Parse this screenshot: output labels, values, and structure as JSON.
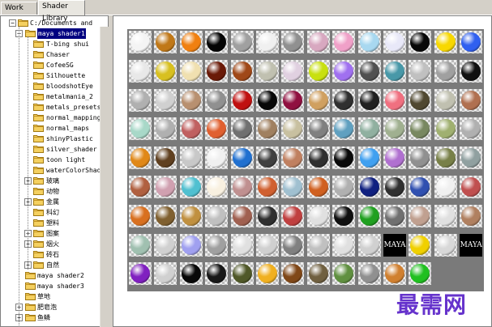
{
  "tabs": [
    {
      "label": "Work Area",
      "active": false
    },
    {
      "label": "Shader Library",
      "active": true
    }
  ],
  "tree": {
    "root": "C:/Documents and",
    "selected": "maya shader1",
    "children_of_selected": [
      "T-bing shui",
      "Chaser",
      "CofeeSG",
      "Silhouette",
      "bloodshotEye",
      "metalmania_2",
      "metals_presets",
      "normal_mapping",
      "normal_maps",
      "shinyPlastic",
      "silver_shader",
      "toon light",
      "waterColorShader"
    ],
    "collapsed_groups": [
      {
        "label": "玻璃",
        "expandable": true
      },
      {
        "label": "动物",
        "expandable": false
      },
      {
        "label": "金属",
        "expandable": true
      },
      {
        "label": "科幻",
        "expandable": false
      },
      {
        "label": "塑料",
        "expandable": false
      },
      {
        "label": "图案",
        "expandable": true
      },
      {
        "label": "烟火",
        "expandable": true
      },
      {
        "label": "砖石",
        "expandable": false
      },
      {
        "label": "自然",
        "expandable": true
      }
    ],
    "siblings": [
      {
        "label": "maya shader2",
        "expandable": false
      },
      {
        "label": "maya shader3",
        "expandable": false
      },
      {
        "label": "草地",
        "expandable": false
      },
      {
        "label": "肥皂泡",
        "expandable": true
      },
      {
        "label": "鱼鳞",
        "expandable": true
      }
    ]
  },
  "watermark": "最需网",
  "swatch_text": "MAYA",
  "colors": {
    "selection": "#000080",
    "watermark": "#6633cc",
    "grid_bg": "#7a7a7a"
  },
  "swatches": [
    [
      "#f4f4f4",
      "#c07818",
      "#f08010",
      "#050505",
      "#a0a0a0",
      "#f0f0f0",
      "#909090",
      "#d8a8c0",
      "#f0a0c8",
      "#a8d8f0",
      "#e8e8f8",
      "#080808",
      "#f8d800",
      "#3060f0"
    ],
    [
      "#e8e8e8",
      "#d8c020",
      "#f0e0b0",
      "#6a1a08",
      "#a04818",
      "#c0c0b0",
      "#e0d0e0",
      "#c8e010",
      "#a070f0",
      "#505050",
      "#4898a8",
      "#c0c0c0",
      "#a0a0a0",
      "#101010"
    ],
    [
      "#b0b0b0",
      "#d0d0d0",
      "#b89070",
      "#909090",
      "#c01010",
      "#080808",
      "#901040",
      "#d0a060",
      "#303030",
      "#202020",
      "#f07080",
      "#504830",
      "#c0c0b0",
      "#b07050"
    ],
    [
      "#a8d8c8",
      "#b0b0b0",
      "#c06060",
      "#e06030",
      "#707070",
      "#a08060",
      "#c8c0a0",
      "#808080",
      "#60a0c0",
      "#90b0a0",
      "#a0b090",
      "#788860",
      "#a0b070",
      "#b0b0b0"
    ],
    [
      "#e08818",
      "#604020",
      "#c8c8c8",
      "#f0f0f0",
      "#2070d0",
      "#404040",
      "#c08060",
      "#303030",
      "#0a0a0a",
      "#40a0f0",
      "#b070d0",
      "#909090",
      "#788048",
      "#90a0a0"
    ],
    [
      "#b06040",
      "#d0a0b0",
      "#50c0d0",
      "#f8f0e0",
      "#c09090",
      "#d06030",
      "#a0c0d0",
      "#d06020",
      "#b0b0b0",
      "#102080",
      "#303030",
      "#3050b0",
      "#f0f0f0",
      "#c05050"
    ],
    [
      "#d87020",
      "#806030",
      "#c09040",
      "#c0c0c0",
      "#a06050",
      "#303030",
      "#c04040",
      "#e0e0e0",
      "#101010",
      "#20a020",
      "#707070",
      "#c0a090",
      "#e0e0e0",
      "#b08060"
    ],
    [
      "#a0c0b0",
      "#d0d0d0",
      "#a0a0f0",
      "#a0a0a0",
      "#e0e0e0",
      "#d0d0d0",
      "#808080",
      "#c0c0c0",
      "#e0e0e0",
      "#d0d0d0",
      "#101010",
      "#f0d000",
      "#d8d8d8",
      "#101010"
    ],
    [
      "#8020c0",
      "#d0d0d0",
      "#080808",
      "#181818",
      "#505828",
      "#f0b020",
      "#804818",
      "#706040",
      "#609040",
      "#909090",
      "#d08030",
      "#20c020"
    ]
  ],
  "text_swatches": [
    [
      7,
      10
    ],
    [
      7,
      13
    ]
  ]
}
